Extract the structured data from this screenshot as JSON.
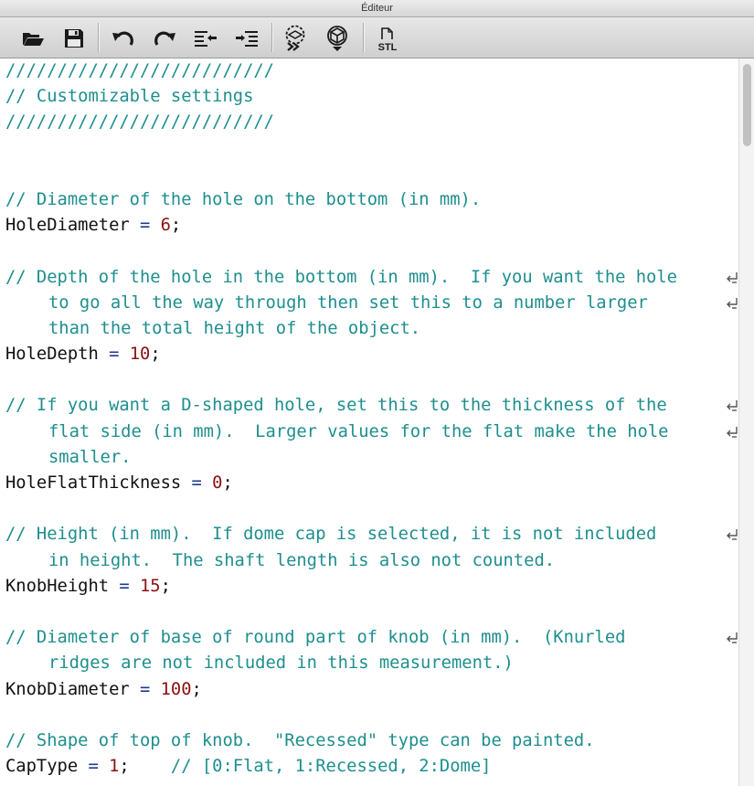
{
  "window": {
    "title": "Éditeur"
  },
  "toolbar": {
    "buttons": [
      {
        "name": "open-file-button",
        "icon": "folder-open-icon"
      },
      {
        "name": "save-file-button",
        "icon": "floppy-disk-icon"
      },
      {
        "name": "undo-button",
        "icon": "undo-icon"
      },
      {
        "name": "redo-button",
        "icon": "redo-icon"
      },
      {
        "name": "unindent-button",
        "icon": "unindent-icon"
      },
      {
        "name": "indent-button",
        "icon": "indent-icon"
      },
      {
        "name": "preview-button",
        "icon": "preview-render-icon"
      },
      {
        "name": "render-button",
        "icon": "render-cube-icon"
      },
      {
        "name": "export-stl-button",
        "icon": "stl-export-icon",
        "label": "STL"
      }
    ]
  },
  "editor": {
    "lines": [
      {
        "comment": "//////////////////////////"
      },
      {
        "comment": "// Customizable settings"
      },
      {
        "comment": "//////////////////////////"
      },
      {
        "blank": true
      },
      {
        "blank": true
      },
      {
        "comment": "// Diameter of the hole on the bottom (in mm)."
      },
      {
        "ident": "HoleDiameter",
        "value": "6"
      },
      {
        "blank": true
      },
      {
        "comment": "// Depth of the hole in the bottom (in mm).  If you want the hole",
        "wrap": true
      },
      {
        "comment": "to go all the way through then set this to a number larger",
        "indent": true,
        "wrap": true
      },
      {
        "comment": "than the total height of the object.",
        "indent": true
      },
      {
        "ident": "HoleDepth",
        "value": "10"
      },
      {
        "blank": true
      },
      {
        "comment": "// If you want a D-shaped hole, set this to the thickness of the",
        "wrap": true
      },
      {
        "comment": "flat side (in mm).  Larger values for the flat make the hole",
        "indent": true,
        "wrap": true
      },
      {
        "comment": "smaller.",
        "indent": true
      },
      {
        "ident": "HoleFlatThickness",
        "value": "0"
      },
      {
        "blank": true
      },
      {
        "comment": "// Height (in mm).  If dome cap is selected, it is not included",
        "wrap": true
      },
      {
        "comment": "in height.  The shaft length is also not counted.",
        "indent": true
      },
      {
        "ident": "KnobHeight",
        "value": "15"
      },
      {
        "blank": true
      },
      {
        "comment": "// Diameter of base of round part of knob (in mm).  (Knurled",
        "wrap": true
      },
      {
        "comment": "ridges are not included in this measurement.)",
        "indent": true
      },
      {
        "ident": "KnobDiameter",
        "value": "100"
      },
      {
        "blank": true
      },
      {
        "comment": "// Shape of top of knob.  \"Recessed\" type can be painted."
      },
      {
        "ident": "CapType",
        "value": "1",
        "trailing": "    // [0:Flat, 1:Recessed, 2:Dome]"
      }
    ]
  },
  "colors": {
    "comment": "#1e8e8e",
    "number": "#8a1010",
    "operator": "#1d3a8f"
  }
}
